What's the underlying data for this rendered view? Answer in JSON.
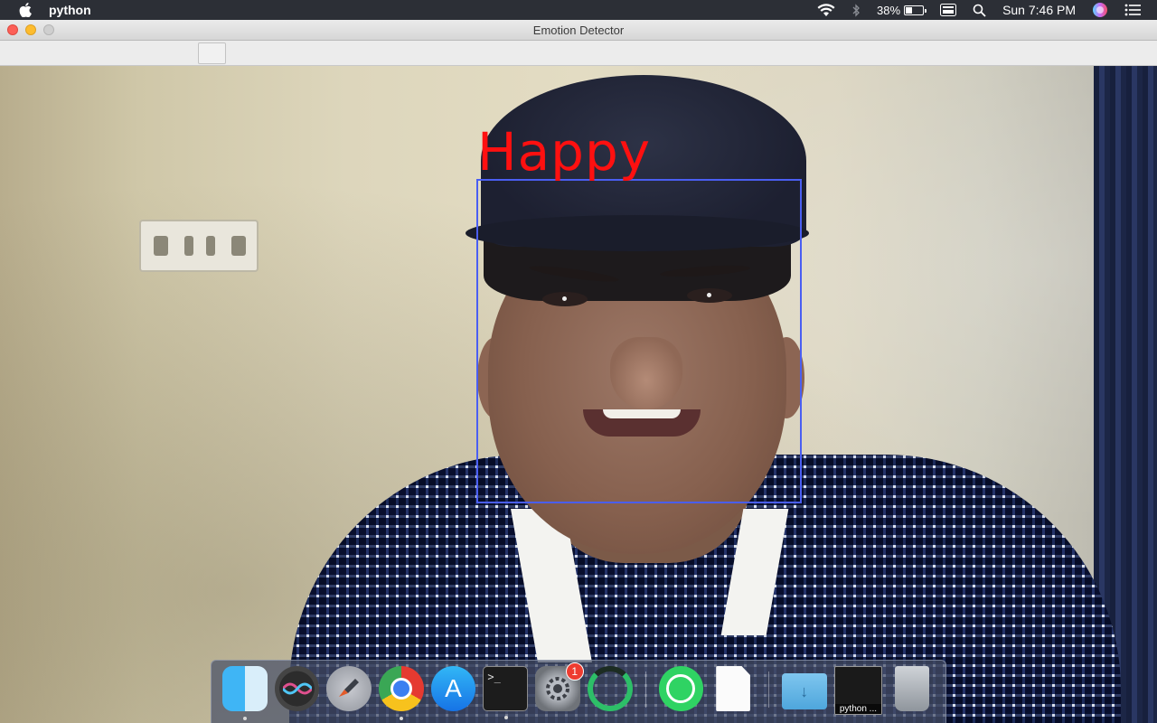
{
  "menubar": {
    "app_name": "python",
    "battery_percent": "38%",
    "battery_level": 0.38,
    "clock": "Sun 7:46 PM",
    "icons": [
      "apple-icon",
      "wifi-icon",
      "bluetooth-icon",
      "battery-icon",
      "input-menu-icon",
      "spotlight-icon",
      "siri-icon",
      "notification-center-icon"
    ]
  },
  "window": {
    "title": "Emotion Detector"
  },
  "detection": {
    "emotion": "Happy",
    "box_color": "#4a5ef2",
    "label_color": "#ff1010"
  },
  "dock": {
    "items": [
      {
        "name": "Finder",
        "icon": "finder-icon",
        "running": true
      },
      {
        "name": "Siri",
        "icon": "siri-icon",
        "running": false
      },
      {
        "name": "Launchpad",
        "icon": "launchpad-icon",
        "running": false
      },
      {
        "name": "Google Chrome",
        "icon": "chrome-icon",
        "running": true
      },
      {
        "name": "App Store",
        "icon": "app-store-icon",
        "running": false
      },
      {
        "name": "Terminal",
        "icon": "terminal-icon",
        "running": true
      },
      {
        "name": "System Preferences",
        "icon": "system-preferences-icon",
        "running": false,
        "badge": "1"
      },
      {
        "name": "Loading app",
        "icon": "ring-icon",
        "running": false
      },
      {
        "name": "WhatsApp",
        "icon": "whatsapp-icon",
        "running": false
      },
      {
        "name": "Document",
        "icon": "document-icon",
        "running": true
      },
      {
        "name": "Downloads",
        "icon": "downloads-folder-icon",
        "running": false
      },
      {
        "name": "python",
        "icon": "python-window-icon",
        "running": false,
        "label": "python ..."
      },
      {
        "name": "Trash",
        "icon": "trash-icon",
        "running": false
      }
    ]
  }
}
